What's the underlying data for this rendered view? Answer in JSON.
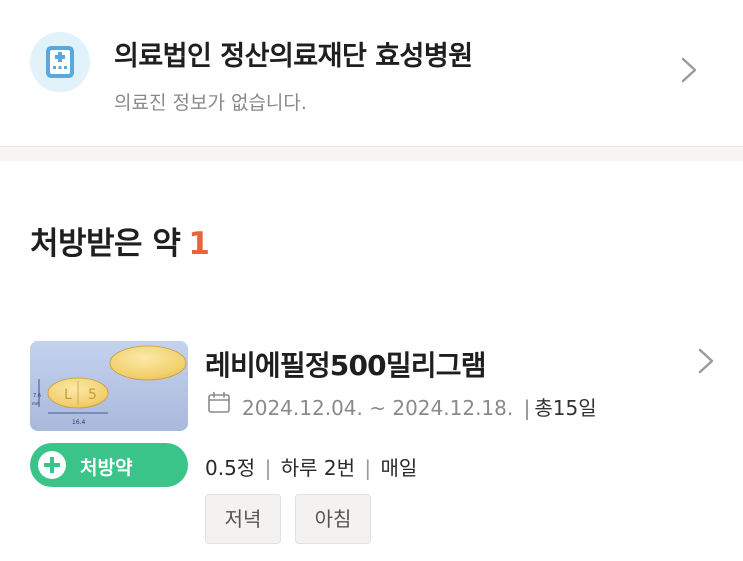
{
  "hospital": {
    "name": "의료법인 정산의료재단 효성병원",
    "subtitle": "의료진 정보가 없습니다.",
    "icon": "hospital-building-icon"
  },
  "prescribed": {
    "title": "처방받은 약",
    "count": "1"
  },
  "medicine": {
    "name": "레비에필정500밀리그램",
    "start_date": "2024.12.04.",
    "range_sep": "~",
    "end_date": "2024.12.18.",
    "divider": "|",
    "total_days": "총15일",
    "badge_label": "처방약",
    "dosage_amount": "0.5정",
    "dosage_frequency": "하루 2번",
    "dosage_schedule": "매일",
    "dosage_divider": "|",
    "times": [
      "저녁",
      "아침"
    ],
    "pill_image": {
      "imprint_left": "L",
      "imprint_right": "5",
      "dimension_length": "16.4",
      "dimension_height": "7.6",
      "unit": "mm"
    }
  },
  "colors": {
    "accent_count": "#e8643b",
    "badge_green": "#3bc48a",
    "icon_bg": "#e1f2fb",
    "divider_bg": "#f6f5f3"
  }
}
